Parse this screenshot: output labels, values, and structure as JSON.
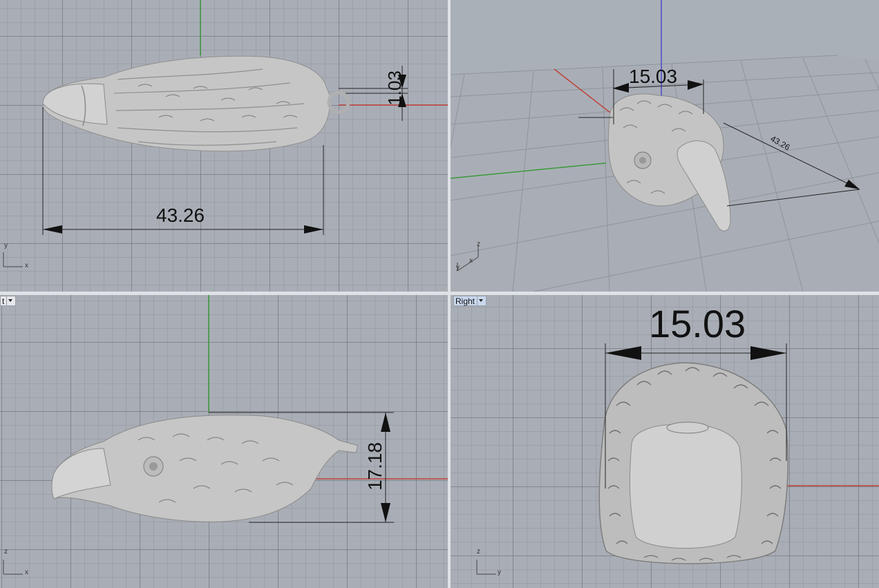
{
  "viewports": {
    "top": {
      "name": "",
      "dims": {
        "length": "43.26",
        "loop": "1.03"
      },
      "axes": {
        "a": "y",
        "b": "x"
      }
    },
    "perspective": {
      "name": "",
      "dims": {
        "width": "15.03",
        "length": "43.26"
      },
      "axes": {
        "a": "z",
        "b": "y",
        "c": "x"
      }
    },
    "front": {
      "tab_label": "t",
      "dims": {
        "height": "17.18"
      },
      "axes": {
        "a": "z",
        "b": "x"
      }
    },
    "right": {
      "tab_label": "Right",
      "dims": {
        "width": "15.03"
      },
      "axes": {
        "a": "z",
        "b": "y"
      }
    }
  },
  "colors": {
    "x_axis": "#c0403a",
    "y_axis": "#3a9a3a",
    "z_axis": "#4a4ac8",
    "model": "#c4c4c4"
  }
}
